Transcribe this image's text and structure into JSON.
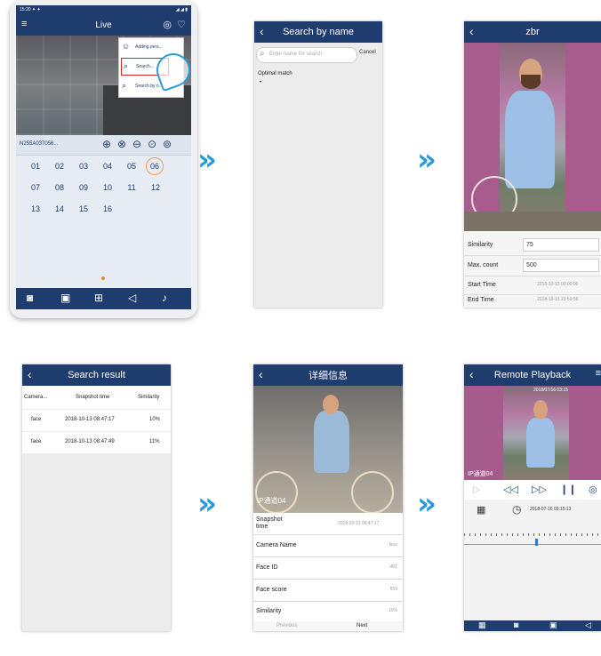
{
  "arrow_glyph": "»",
  "screen1": {
    "status": "15:20 ✦ ✦",
    "status_right": "◢ ◢ ▮",
    "title": "Live",
    "menu": [
      {
        "label": "Adding pers..."
      },
      {
        "label": "Search..."
      },
      {
        "label": "Search by n..."
      }
    ],
    "device": "N255A037056...",
    "channels": [
      "01",
      "02",
      "03",
      "04",
      "05",
      "06",
      "07",
      "08",
      "09",
      "10",
      "11",
      "12",
      "13",
      "14",
      "15",
      "16"
    ],
    "selected_channel": "06"
  },
  "screen2": {
    "title": "Search by name",
    "placeholder": "Enter name for search",
    "cancel": "Cancel",
    "match_label": "Optimal match",
    "bullet": "•"
  },
  "screen3": {
    "title": "zbr",
    "fields": [
      {
        "label": "Similarity",
        "value": "75"
      },
      {
        "label": "Max. count",
        "value": "500"
      },
      {
        "label": "Start Time",
        "value": "2018-10-13 00:00:00"
      },
      {
        "label": "End Time",
        "value": "2018-10-13 23:59:59"
      }
    ]
  },
  "screen4": {
    "title": "Search result",
    "headers": [
      "Camera...",
      "Snapshot time",
      "Similarity"
    ],
    "rows": [
      [
        "face",
        "2018-10-13 08:47:17",
        "10%"
      ],
      [
        "face",
        "2018-10-13 08:47:49",
        "11%"
      ]
    ]
  },
  "screen5": {
    "title": "详细信息",
    "overlay": "IP通道04",
    "fields": [
      {
        "label": "Snapshot time",
        "value": "2018-10-13 08:47:17"
      },
      {
        "label": "Camera Name",
        "value": "face"
      },
      {
        "label": "Face ID",
        "value": "401"
      },
      {
        "label": "Face score",
        "value": "559"
      },
      {
        "label": "Similarity",
        "value": "10%"
      }
    ],
    "prev": "Previous",
    "next": "Next"
  },
  "screen6": {
    "title": "Remote Playback",
    "timestamp": "2018/07/16 03:15",
    "overlay": "IP通道04",
    "date_time": "2018-07-16 03:15:13"
  }
}
